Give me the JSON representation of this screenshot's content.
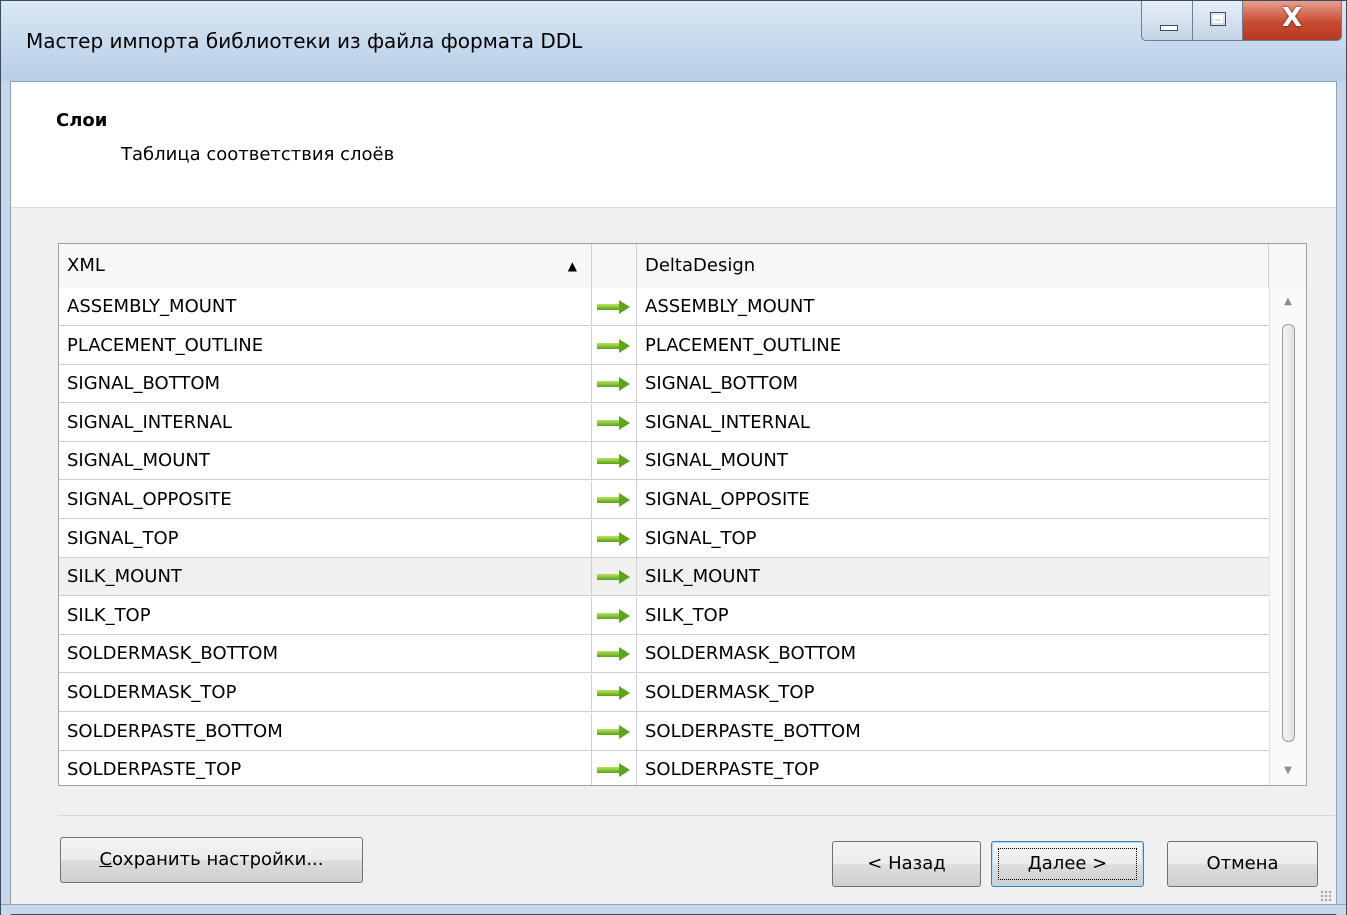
{
  "window": {
    "title": "Мастер импорта библиотеки из файла формата DDL",
    "controls": {
      "minimize": "minimize-icon",
      "maximize": "maximize-icon",
      "close": "X"
    }
  },
  "header": {
    "title": "Слои",
    "subtitle": "Таблица соответствия слоёв"
  },
  "grid": {
    "columns": {
      "xml": "XML",
      "deltadesign": "DeltaDesign"
    },
    "sort": {
      "column": "XML",
      "direction": "ascending"
    },
    "rows": [
      {
        "xml": "ASSEMBLY_MOUNT",
        "dd": "ASSEMBLY_MOUNT"
      },
      {
        "xml": "PLACEMENT_OUTLINE",
        "dd": "PLACEMENT_OUTLINE"
      },
      {
        "xml": "SIGNAL_BOTTOM",
        "dd": "SIGNAL_BOTTOM"
      },
      {
        "xml": "SIGNAL_INTERNAL",
        "dd": "SIGNAL_INTERNAL"
      },
      {
        "xml": "SIGNAL_MOUNT",
        "dd": "SIGNAL_MOUNT"
      },
      {
        "xml": "SIGNAL_OPPOSITE",
        "dd": "SIGNAL_OPPOSITE"
      },
      {
        "xml": "SIGNAL_TOP",
        "dd": "SIGNAL_TOP"
      },
      {
        "xml": "SILK_MOUNT",
        "dd": "SILK_MOUNT"
      },
      {
        "xml": "SILK_TOP",
        "dd": "SILK_TOP"
      },
      {
        "xml": "SOLDERMASK_BOTTOM",
        "dd": "SOLDERMASK_BOTTOM"
      },
      {
        "xml": "SOLDERMASK_TOP",
        "dd": "SOLDERMASK_TOP"
      },
      {
        "xml": "SOLDERPASTE_BOTTOM",
        "dd": "SOLDERPASTE_BOTTOM"
      },
      {
        "xml": "SOLDERPASTE_TOP",
        "dd": "SOLDERPASTE_TOP"
      }
    ],
    "highlighted_row": 7
  },
  "buttons": {
    "save_prefix": "С",
    "save_rest": "охранить настройки...",
    "back": "< Назад",
    "next_prefix": "Д",
    "next_rest": "алее >",
    "cancel": "Отмена"
  },
  "colors": {
    "arrow": "#5ea51f",
    "title_bar": "#c9dbee",
    "close": "#c74b32",
    "default_button_border": "#3c7fb1"
  }
}
